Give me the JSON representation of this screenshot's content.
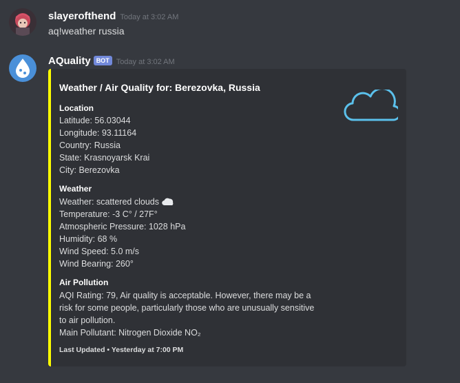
{
  "messages": [
    {
      "username": "slayerofthend",
      "timestamp": "Today at 3:02 AM",
      "content": "aq!weather russia"
    },
    {
      "username": "AQuality",
      "bot_tag": "BOT",
      "timestamp": "Today at 3:02 AM"
    }
  ],
  "embed": {
    "title": "Weather / Air Quality for: Berezovka, Russia",
    "accent_color": "#ffff00",
    "thumbnail_icon": "cloud-icon",
    "location": {
      "name": "Location",
      "lines": [
        "Latitude: 56.03044",
        "Longitude: 93.11164",
        "Country: Russia",
        "State: Krasnoyarsk Krai",
        "City: Berezovka"
      ]
    },
    "weather": {
      "name": "Weather",
      "lines": [
        "Weather: scattered clouds",
        "Temperature: -3 C° / 27F°",
        "Atmospheric Pressure: 1028 hPa",
        "Humidity: 68 %",
        "Wind Speed: 5.0 m/s",
        "Wind Bearing: 260°"
      ]
    },
    "pollution": {
      "name": "Air Pollution",
      "lines": [
        "AQI Rating: 79, Air quality is acceptable. However, there may be a",
        "risk for some people, particularly those who are unusually sensitive",
        "to air pollution.",
        "Main Pollutant: Nitrogen Dioxide NO₂"
      ]
    },
    "footer": "Last Updated • Yesterday at 7:00 PM"
  }
}
